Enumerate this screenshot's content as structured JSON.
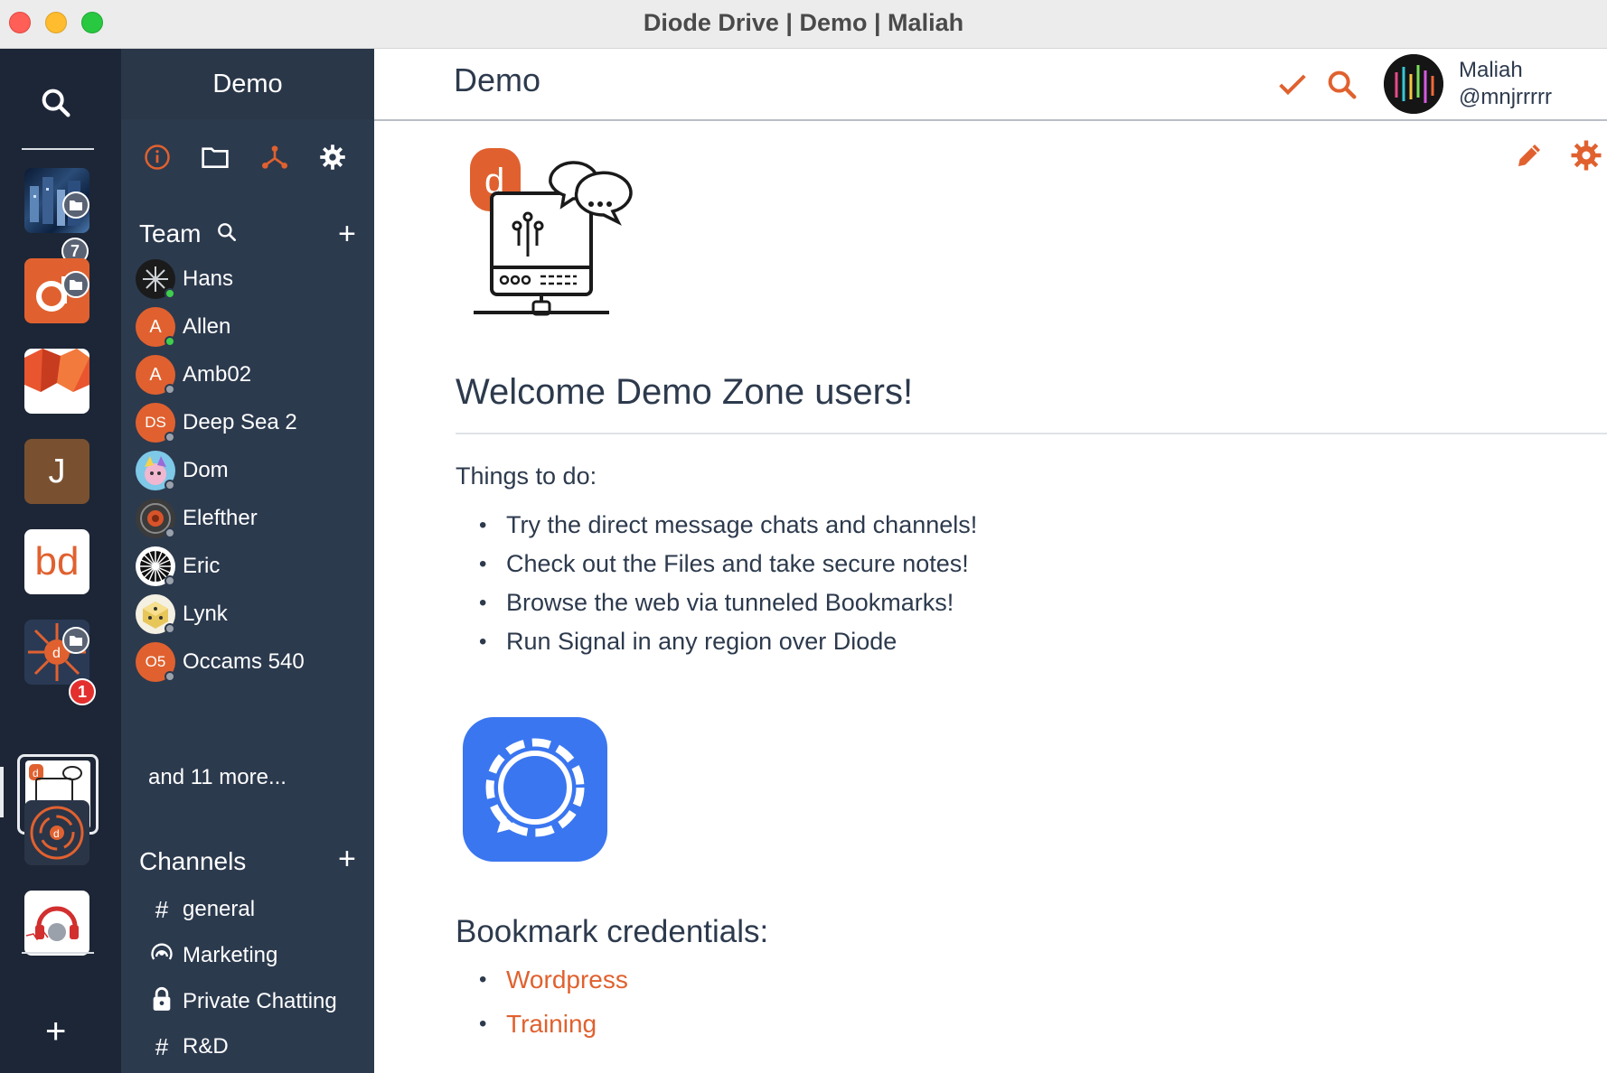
{
  "window": {
    "title": "Diode Drive | Demo | Maliah"
  },
  "rail": {
    "zones": [
      {
        "name": "zone-city",
        "count": "7"
      },
      {
        "name": "zone-diode-orange"
      },
      {
        "name": "zone-red-mountain"
      },
      {
        "name": "zone-j",
        "letter": "J"
      },
      {
        "name": "zone-bd",
        "letter": "bd"
      },
      {
        "name": "zone-network",
        "count": "1"
      },
      {
        "name": "zone-demo"
      },
      {
        "name": "zone-orbit"
      },
      {
        "name": "zone-radio"
      }
    ],
    "add_label": "+"
  },
  "sidebar": {
    "title": "Demo",
    "team_label": "Team",
    "plus": "+",
    "members": [
      {
        "name": "Hans",
        "initials": "",
        "status": "online"
      },
      {
        "name": "Allen",
        "initials": "A",
        "status": "online"
      },
      {
        "name": "Amb02",
        "initials": "A",
        "status": "offline"
      },
      {
        "name": "Deep Sea 2",
        "initials": "DS",
        "status": "offline"
      },
      {
        "name": "Dom",
        "initials": "",
        "status": "offline"
      },
      {
        "name": "Elefther",
        "initials": "",
        "status": "offline"
      },
      {
        "name": "Eric",
        "initials": "",
        "status": "offline"
      },
      {
        "name": "Lynk",
        "initials": "",
        "status": "offline"
      },
      {
        "name": "Occams 540",
        "initials": "O5",
        "status": "offline"
      }
    ],
    "more": "and 11 more...",
    "channels_label": "Channels",
    "channels": [
      {
        "name": "general",
        "icon": "#"
      },
      {
        "name": "Marketing",
        "icon": "broadcast"
      },
      {
        "name": "Private Chatting",
        "icon": "lock"
      },
      {
        "name": "R&D",
        "icon": "#"
      }
    ]
  },
  "main": {
    "title": "Demo",
    "user": {
      "name": "Maliah",
      "handle": "@mnjrrrrr"
    },
    "welcome": "Welcome Demo Zone users!",
    "things_label": "Things to do:",
    "todos": [
      "Try the direct message chats and channels!",
      "Check out the Files and take secure notes!",
      "Browse the web via tunneled Bookmarks!",
      "Run Signal in any region over Diode"
    ],
    "bookmarks_title": "Bookmark credentials:",
    "bookmarks": [
      "Wordpress",
      "Training"
    ]
  },
  "colors": {
    "accent": "#e0612f",
    "rail_bg": "#1d2636",
    "sidebar_bg": "#2c3a4e",
    "text": "#2d3a4d",
    "online": "#3ecf4c",
    "offline": "#9aa1ab"
  },
  "icons": {
    "rail": [
      "search-icon",
      "folder-icon",
      "plus-icon"
    ],
    "sidebar": [
      "info-icon",
      "folder-icon",
      "network-icon",
      "gear-icon",
      "search-icon",
      "plus-icon",
      "hash-icon",
      "broadcast-icon",
      "lock-icon"
    ],
    "header": [
      "check-icon",
      "search-icon",
      "pencil-icon",
      "gear-icon"
    ]
  }
}
